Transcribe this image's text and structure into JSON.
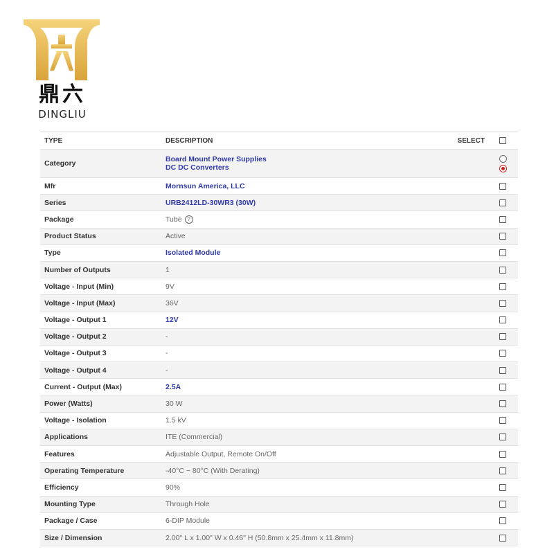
{
  "brand": {
    "name_cn": "鼎六",
    "name_en": "DINGLIU",
    "gold": "#e0b040"
  },
  "table": {
    "headers": {
      "type": "TYPE",
      "description": "DESCRIPTION",
      "select": "SELECT"
    },
    "category": {
      "label": "Category",
      "lines": [
        "Board Mount Power Supplies",
        "DC DC Converters"
      ]
    },
    "rows": [
      {
        "label": "Mfr",
        "value": "Mornsun America, LLC",
        "link": true
      },
      {
        "label": "Series",
        "value": "URB2412LD-30WR3 (30W)",
        "link": true
      },
      {
        "label": "Package",
        "value": "Tube",
        "link": false,
        "help": true
      },
      {
        "label": "Product Status",
        "value": "Active",
        "link": false
      },
      {
        "label": "Type",
        "value": "Isolated Module",
        "link": true
      },
      {
        "label": "Number of Outputs",
        "value": "1",
        "link": false
      },
      {
        "label": "Voltage - Input (Min)",
        "value": "9V",
        "link": false
      },
      {
        "label": "Voltage - Input (Max)",
        "value": "36V",
        "link": false
      },
      {
        "label": "Voltage - Output 1",
        "value": "12V",
        "link": true
      },
      {
        "label": "Voltage - Output 2",
        "value": "-",
        "link": false
      },
      {
        "label": "Voltage - Output 3",
        "value": "-",
        "link": false
      },
      {
        "label": "Voltage - Output 4",
        "value": "-",
        "link": false
      },
      {
        "label": "Current - Output (Max)",
        "value": "2.5A",
        "link": true
      },
      {
        "label": "Power (Watts)",
        "value": "30 W",
        "link": false
      },
      {
        "label": "Voltage - Isolation",
        "value": "1.5 kV",
        "link": false
      },
      {
        "label": "Applications",
        "value": "ITE (Commercial)",
        "link": false
      },
      {
        "label": "Features",
        "value": "Adjustable Output, Remote On/Off",
        "link": false
      },
      {
        "label": "Operating Temperature",
        "value": "-40°C ~ 80°C (With Derating)",
        "link": false
      },
      {
        "label": "Efficiency",
        "value": "90%",
        "link": false
      },
      {
        "label": "Mounting Type",
        "value": "Through Hole",
        "link": false
      },
      {
        "label": "Package / Case",
        "value": "6-DIP Module",
        "link": false
      },
      {
        "label": "Size / Dimension",
        "value": "2.00\" L x 1.00\" W x 0.46\" H (50.8mm x 25.4mm x 11.8mm)",
        "link": false
      }
    ]
  }
}
